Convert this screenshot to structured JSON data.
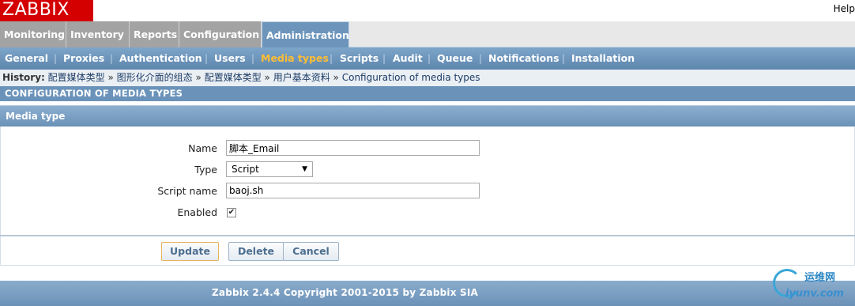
{
  "header": {
    "logo": "ZABBIX",
    "help": "Help"
  },
  "main_menu": [
    {
      "label": "Monitoring"
    },
    {
      "label": "Inventory"
    },
    {
      "label": "Reports"
    },
    {
      "label": "Configuration"
    },
    {
      "label": "Administration",
      "active": true
    }
  ],
  "sub_menu": [
    {
      "label": "General"
    },
    {
      "label": "Proxies"
    },
    {
      "label": "Authentication"
    },
    {
      "label": "Users"
    },
    {
      "label": "Media types",
      "active": true
    },
    {
      "label": "Scripts"
    },
    {
      "label": "Audit"
    },
    {
      "label": "Queue"
    },
    {
      "label": "Notifications"
    },
    {
      "label": "Installation"
    }
  ],
  "sub_menu_separator": "|",
  "history": {
    "label": "History:",
    "items": [
      "配置媒体类型",
      "图形化介面的组态",
      "配置媒体类型",
      "用户基本资料",
      "Configuration of media types"
    ],
    "separator": "»"
  },
  "page_title": "CONFIGURATION OF MEDIA TYPES",
  "form": {
    "title": "Media type",
    "name_label": "Name",
    "name_value": "脚本_Email",
    "type_label": "Type",
    "type_value": "Script",
    "script_name_label": "Script name",
    "script_name_value": "baoj.sh",
    "enabled_label": "Enabled",
    "enabled": true
  },
  "buttons": {
    "update": "Update",
    "delete": "Delete",
    "cancel": "Cancel"
  },
  "footer": {
    "copyright": "Zabbix 2.4.4 Copyright 2001-2015 by Zabbix SIA"
  },
  "watermark": {
    "cn": "运维网",
    "en": "iyunv.com"
  },
  "colors": {
    "logo_bg": "#d40000",
    "active_tab": "#6d95bb",
    "active_sub": "#ffbe33",
    "header_blue": "#6b93ba"
  }
}
